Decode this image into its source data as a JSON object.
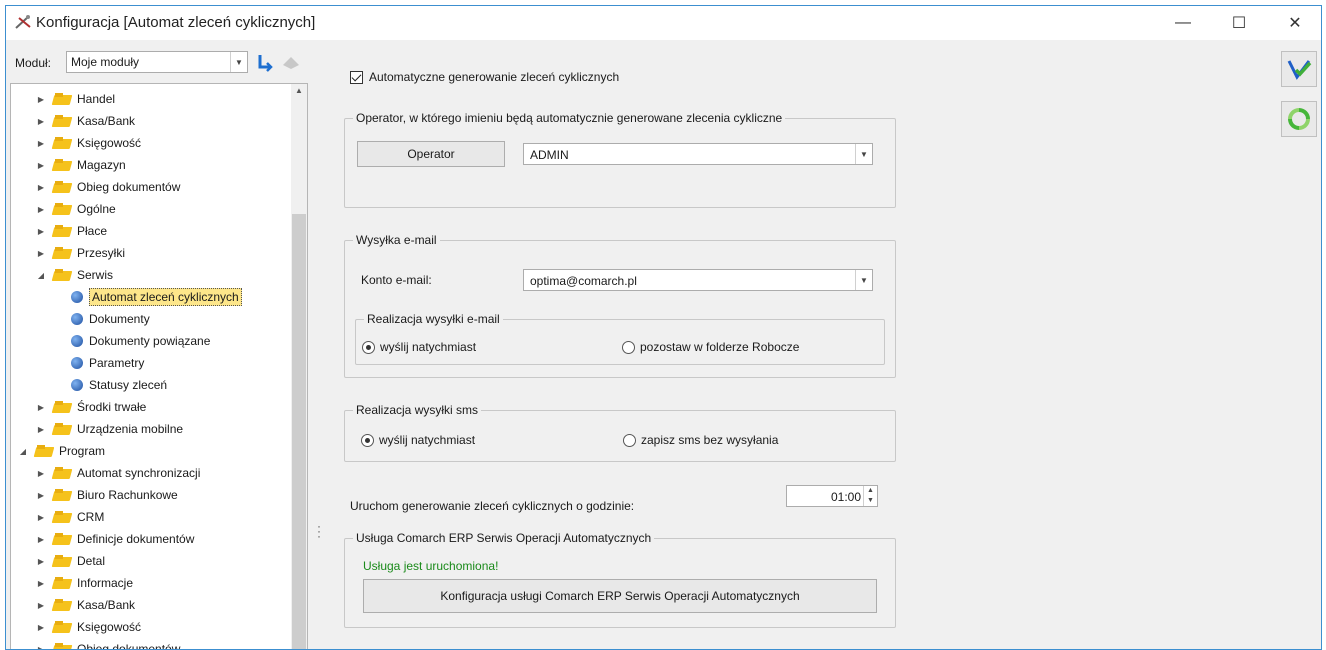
{
  "window": {
    "title": "Konfiguracja [Automat zleceń cyklicznych]",
    "minimize_glyph": "—",
    "maximize_glyph": "☐",
    "close_glyph": "✕"
  },
  "left": {
    "modul_label": "Moduł:",
    "modul_value": "Moje moduły",
    "tree": [
      {
        "label": "Handel",
        "level": 1,
        "type": "folder",
        "expander": "▶"
      },
      {
        "label": "Kasa/Bank",
        "level": 1,
        "type": "folder",
        "expander": "▶"
      },
      {
        "label": "Księgowość",
        "level": 1,
        "type": "folder",
        "expander": "▶"
      },
      {
        "label": "Magazyn",
        "level": 1,
        "type": "folder",
        "expander": "▶"
      },
      {
        "label": "Obieg dokumentów",
        "level": 1,
        "type": "folder",
        "expander": "▶"
      },
      {
        "label": "Ogólne",
        "level": 1,
        "type": "folder",
        "expander": "▶"
      },
      {
        "label": "Płace",
        "level": 1,
        "type": "folder",
        "expander": "▶"
      },
      {
        "label": "Przesyłki",
        "level": 1,
        "type": "folder",
        "expander": "▶"
      },
      {
        "label": "Serwis",
        "level": 1,
        "type": "folder",
        "expander": "◢"
      },
      {
        "label": "Automat zleceń cyklicznych",
        "level": 2,
        "type": "leaf",
        "selected": true
      },
      {
        "label": "Dokumenty",
        "level": 2,
        "type": "leaf"
      },
      {
        "label": "Dokumenty powiązane",
        "level": 2,
        "type": "leaf"
      },
      {
        "label": "Parametry",
        "level": 2,
        "type": "leaf"
      },
      {
        "label": "Statusy zleceń",
        "level": 2,
        "type": "leaf"
      },
      {
        "label": "Środki trwałe",
        "level": 1,
        "type": "folder",
        "expander": "▶"
      },
      {
        "label": "Urządzenia mobilne",
        "level": 1,
        "type": "folder",
        "expander": "▶"
      },
      {
        "label": "Program",
        "level": 0,
        "type": "folder",
        "expander": "◢"
      },
      {
        "label": "Automat synchronizacji",
        "level": 1,
        "type": "folder",
        "expander": "▶"
      },
      {
        "label": "Biuro Rachunkowe",
        "level": 1,
        "type": "folder",
        "expander": "▶"
      },
      {
        "label": "CRM",
        "level": 1,
        "type": "folder",
        "expander": "▶"
      },
      {
        "label": "Definicje dokumentów",
        "level": 1,
        "type": "folder",
        "expander": "▶"
      },
      {
        "label": "Detal",
        "level": 1,
        "type": "folder",
        "expander": "▶"
      },
      {
        "label": "Informacje",
        "level": 1,
        "type": "folder",
        "expander": "▶"
      },
      {
        "label": "Kasa/Bank",
        "level": 1,
        "type": "folder",
        "expander": "▶"
      },
      {
        "label": "Księgowość",
        "level": 1,
        "type": "folder",
        "expander": "▶"
      },
      {
        "label": "Obieg dokumentów",
        "level": 1,
        "type": "folder",
        "expander": "▶"
      }
    ]
  },
  "content": {
    "auto_generate_label": "Automatyczne generowanie zleceń cyklicznych",
    "auto_generate_checked": true,
    "operator_group": {
      "legend": "Operator, w którego imieniu będą automatycznie generowane zlecenia cykliczne",
      "button": "Operator",
      "value": "ADMIN"
    },
    "email_group": {
      "legend": "Wysyłka e-mail",
      "account_label": "Konto e-mail:",
      "account_value": "optima@comarch.pl",
      "realization_legend": "Realizacja wysyłki e-mail",
      "option_send": "wyślij natychmiast",
      "option_drafts": "pozostaw w folderze Robocze",
      "selected": "send"
    },
    "sms_group": {
      "legend": "Realizacja wysyłki sms",
      "option_send": "wyślij natychmiast",
      "option_save": "zapisz sms bez wysyłania",
      "selected": "send"
    },
    "time_label": "Uruchom generowanie zleceń cyklicznych o godzinie:",
    "time_value": "01:00",
    "service_group": {
      "legend": "Usługa Comarch ERP Serwis Operacji Automatycznych",
      "status": "Usługa jest uruchomiona!",
      "button": "Konfiguracja usługi Comarch ERP Serwis Operacji Automatycznych"
    }
  },
  "icons": {
    "save": "save-icon",
    "refresh": "refresh-icon"
  }
}
